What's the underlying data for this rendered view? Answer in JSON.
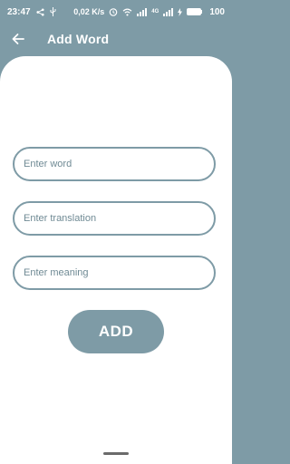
{
  "status_bar": {
    "time": "23:47",
    "data_rate": "0,02 K/s",
    "network": "4G",
    "battery_level": "100",
    "icons": [
      "share-icon",
      "usb-icon",
      "alarm-icon",
      "wifi-icon",
      "signal-icon",
      "signal-icon",
      "charging-icon",
      "battery-icon"
    ]
  },
  "app_bar": {
    "back_icon": "arrow-left-icon",
    "title": "Add Word"
  },
  "form": {
    "word_placeholder": "Enter word",
    "translation_placeholder": "Enter translation",
    "meaning_placeholder": "Enter meaning",
    "word_value": "",
    "translation_value": "",
    "meaning_value": "",
    "add_label": "ADD"
  },
  "colors": {
    "primary": "#7e9ba6",
    "surface": "#ffffff"
  }
}
